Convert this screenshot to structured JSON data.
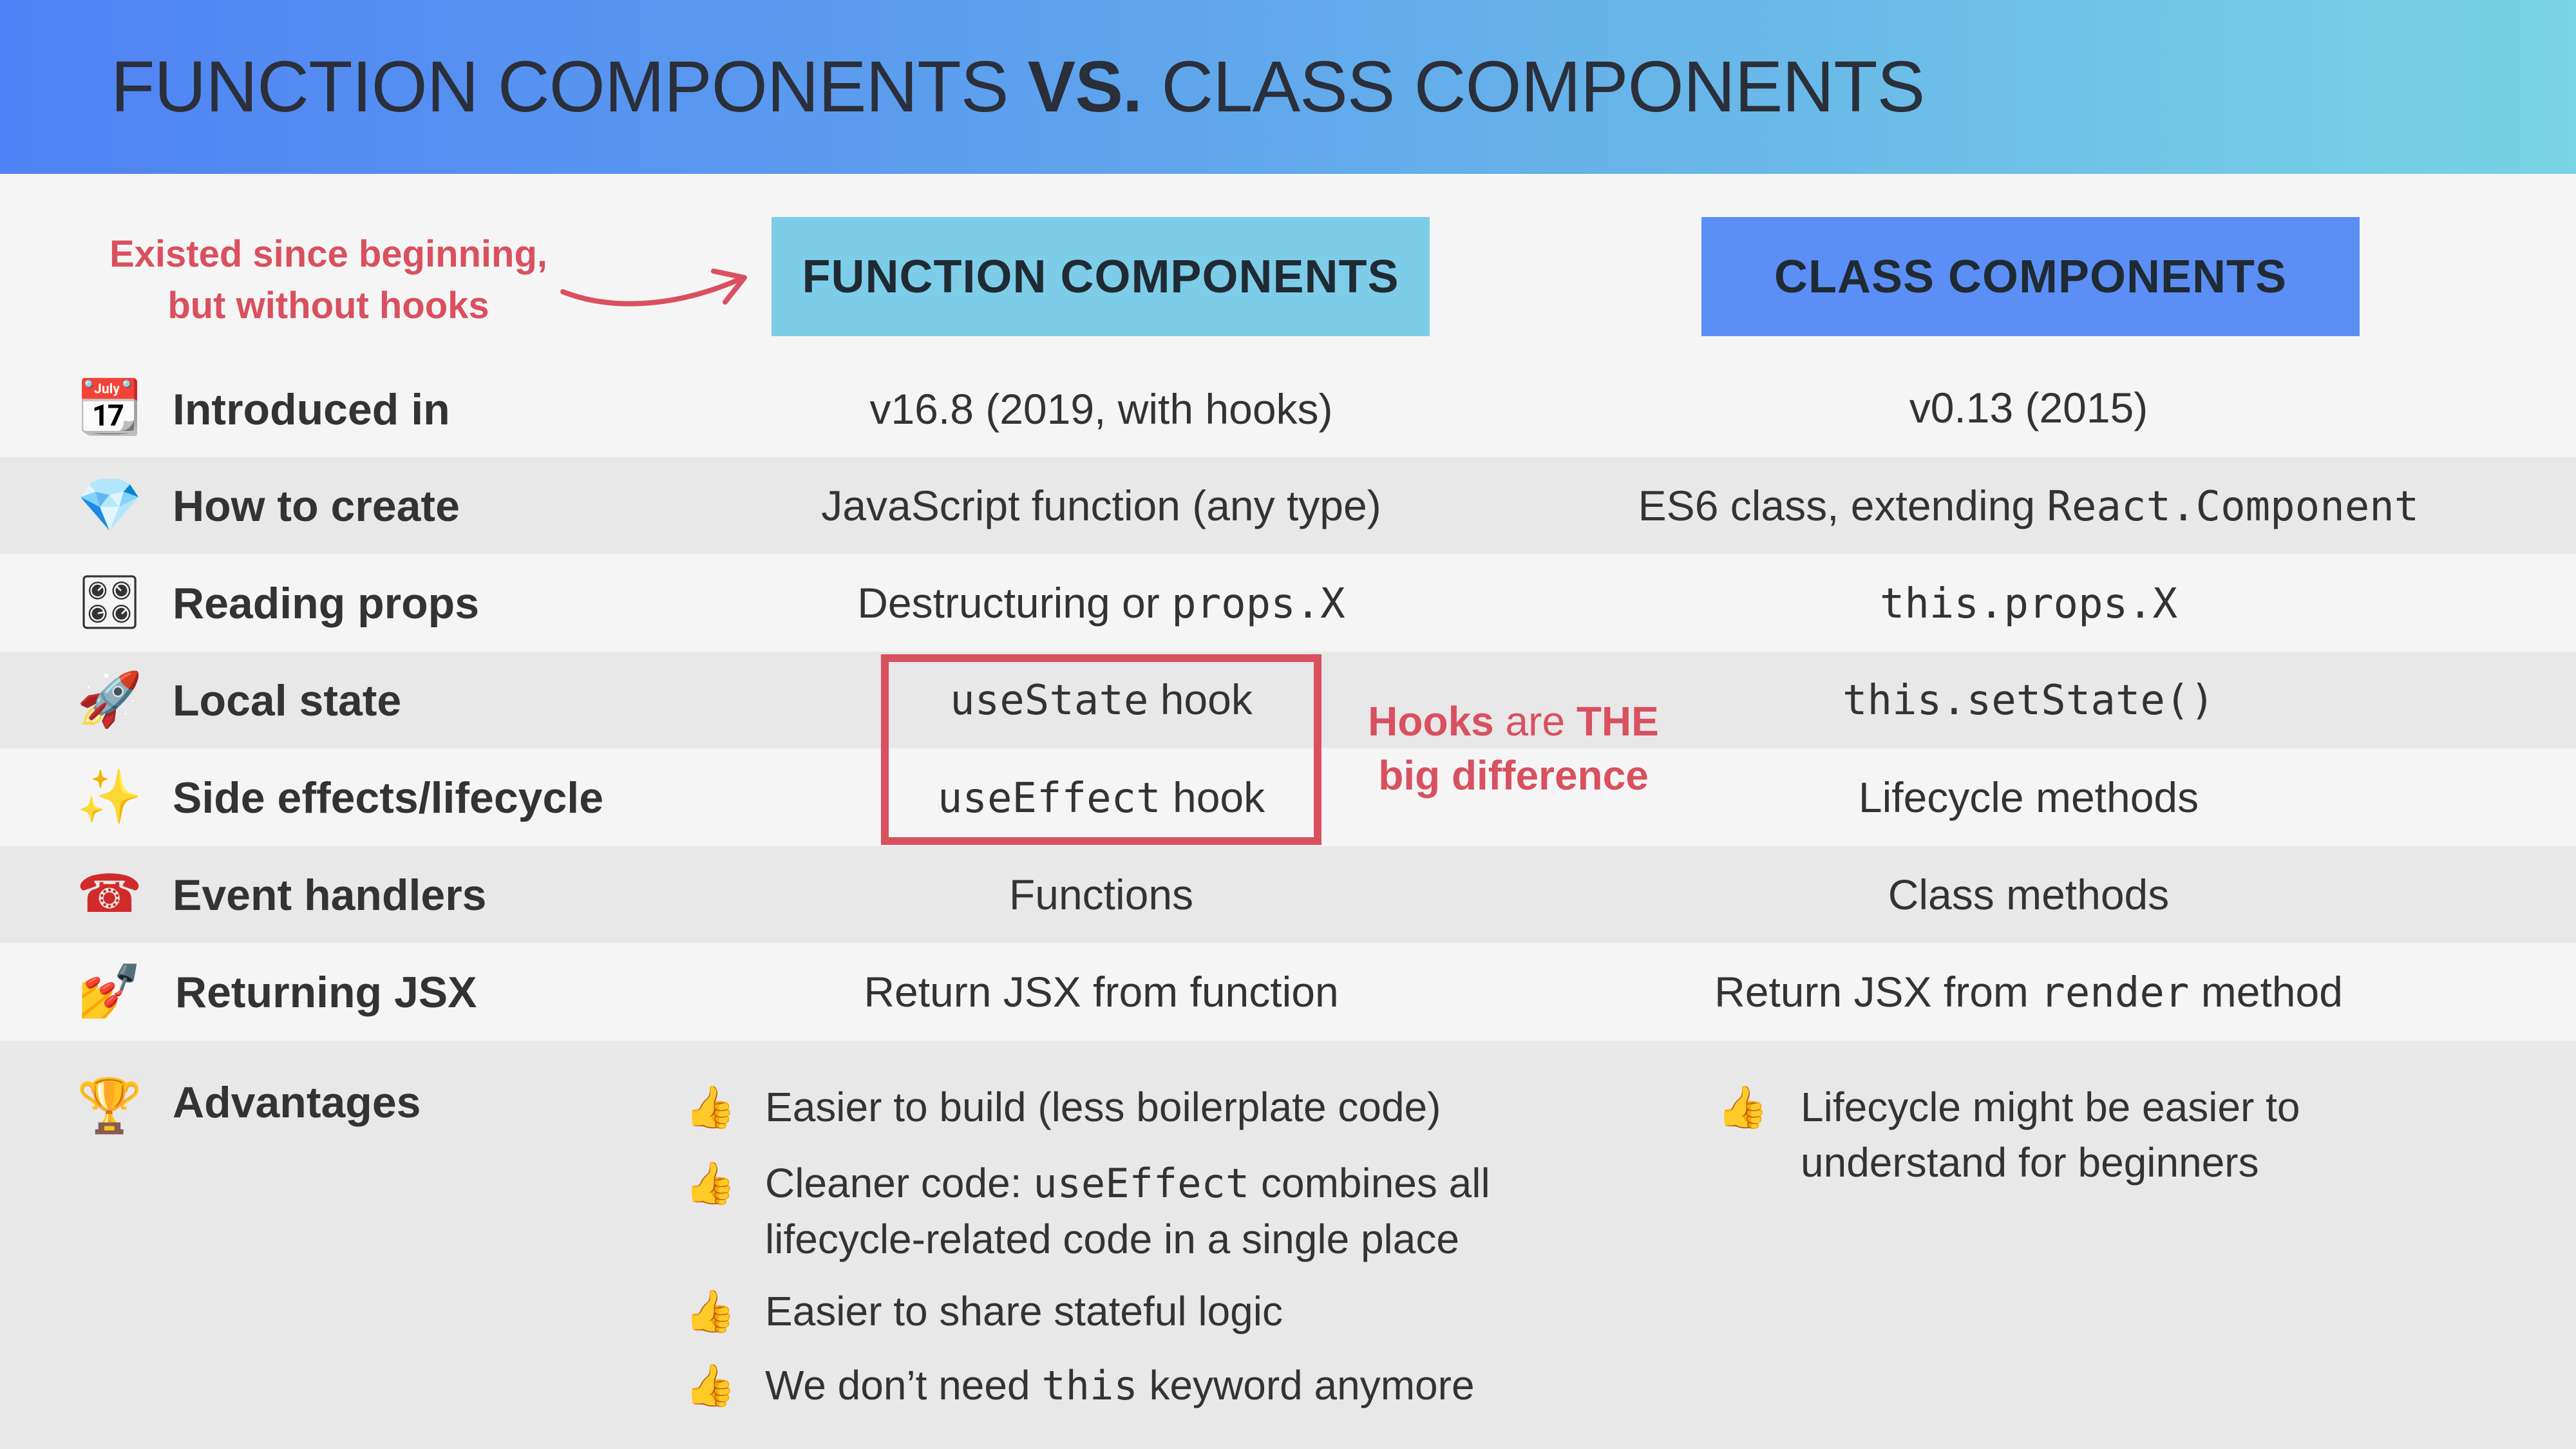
{
  "title": {
    "part1": "FUNCTION COMPONENTS",
    "vs": "VS.",
    "part2": "CLASS COMPONENTS"
  },
  "note_top": {
    "line1": "Existed since beginning,",
    "line2": "but without hooks"
  },
  "note_hooks": {
    "line1_a": "Hooks",
    "line1_b": "are",
    "line1_c": "THE",
    "line2": "big difference"
  },
  "columns": {
    "function": "FUNCTION COMPONENTS",
    "class": "CLASS COMPONENTS"
  },
  "rows": [
    {
      "icon": "📆",
      "label": "Introduced in",
      "fn": "v16.8 (2019, with hooks)",
      "cls": "v0.13 (2015)"
    },
    {
      "icon": "💎",
      "label": "How to create",
      "fn": "JavaScript function (any type)",
      "cls_text": "ES6 class, extending ",
      "cls_code": "React.Component"
    },
    {
      "icon": "🎛",
      "label": "Reading props",
      "fn_text": "Destructuring or ",
      "fn_code": "props.X",
      "cls_code": "this.props.X"
    },
    {
      "icon": "🚀",
      "label": "Local state",
      "fn_code": "useState",
      "fn_text": " hook",
      "cls_code": "this.setState()"
    },
    {
      "icon": "✨",
      "label": "Side effects/lifecycle",
      "fn_code": "useEffect",
      "fn_text": " hook",
      "cls": "Lifecycle methods"
    },
    {
      "icon": "☎",
      "label": "Event handlers",
      "fn": "Functions",
      "cls": "Class methods"
    },
    {
      "icon": "💅",
      "label": "Returning JSX",
      "fn": "Return JSX from function",
      "cls_text1": "Return JSX from ",
      "cls_code": "render",
      "cls_text2": " method"
    }
  ],
  "advantages": {
    "icon": "🏆",
    "label": "Advantages",
    "thumb": "👍",
    "fn": [
      {
        "text": "Easier to build (less boilerplate code)"
      },
      {
        "text1": "Cleaner code: ",
        "code": "useEffect",
        "text2": " combines all",
        "line2": "lifecycle-related code in a single place"
      },
      {
        "text": "Easier to share stateful logic"
      },
      {
        "text1": "We don’t need ",
        "code": "this",
        "text2": " keyword anymore"
      }
    ],
    "cls": [
      {
        "line1": "Lifecycle might be easier to",
        "line2": "understand for beginners"
      }
    ]
  }
}
